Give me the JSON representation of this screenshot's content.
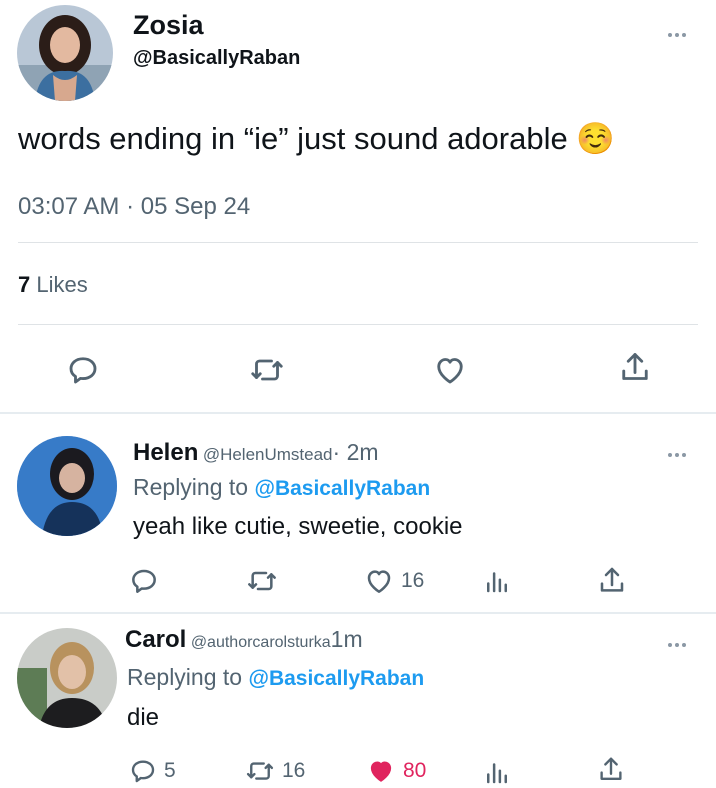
{
  "main_tweet": {
    "display_name": "Zosia",
    "handle": "@BasicallyRaban",
    "text": "words ending in “ie” just sound adorable",
    "emoji": "☺️",
    "timestamp": "03:07 AM · 05 Sep 24",
    "likes_count": "7",
    "likes_label": "Likes"
  },
  "replies": [
    {
      "display_name": "Helen",
      "handle": "@HelenUmstead",
      "time": "· 2m",
      "replying_prefix": "Replying to",
      "replying_handle": "@BasicallyRaban",
      "text": "yeah like cutie, sweetie, cookie",
      "reply_count": "",
      "retweet_count": "",
      "like_count": "16",
      "liked": false
    },
    {
      "display_name": "Carol",
      "handle": "@authorcarolsturka",
      "time": "1m",
      "replying_prefix": "Replying to",
      "replying_handle": "@BasicallyRaban",
      "text": "die",
      "reply_count": "5",
      "retweet_count": "16",
      "like_count": "80",
      "liked": true
    }
  ],
  "colors": {
    "text": "#0f1419",
    "secondary": "#536471",
    "link": "#1d9bf0",
    "like_active": "#e0245e",
    "divider": "#dfe3e6"
  }
}
